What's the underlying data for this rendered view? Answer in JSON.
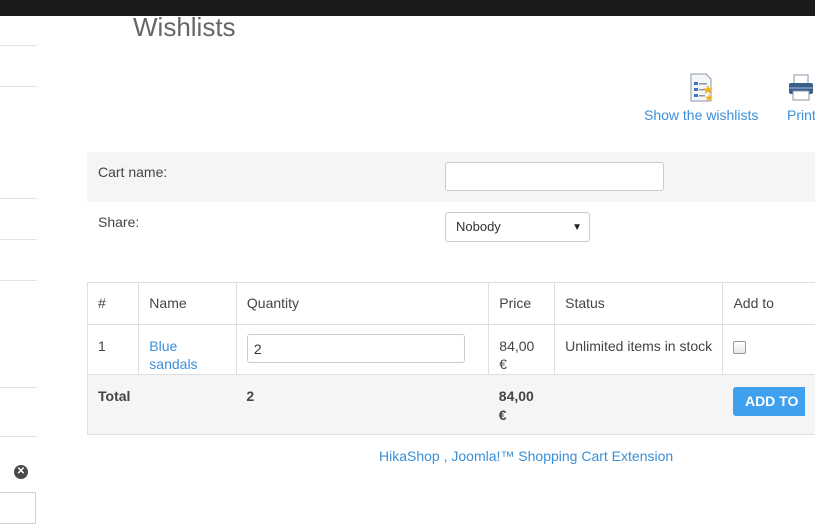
{
  "page": {
    "title": "Wishlists"
  },
  "toolbar": {
    "show_wishlists_label": "Show the wishlists",
    "print_label": "Print"
  },
  "form": {
    "cart_name_label": "Cart name:",
    "cart_name_value": "",
    "share_label": "Share:",
    "share_selected": "Nobody"
  },
  "table": {
    "headers": {
      "num": "#",
      "name": "Name",
      "quantity": "Quantity",
      "price": "Price",
      "status": "Status",
      "add_to": "Add to"
    },
    "rows": [
      {
        "num": "1",
        "name": "Blue sandals",
        "quantity": "2",
        "price": "84,00 €",
        "status": "Unlimited items in stock"
      }
    ],
    "total": {
      "label": "Total",
      "quantity": "2",
      "price": "84,00 €",
      "button": "ADD TO"
    }
  },
  "footer": {
    "credit": "HikaShop , Joomla!™ Shopping Cart Extension"
  },
  "colors": {
    "link": "#3a8fd9",
    "button": "#3ea0ee",
    "topbar": "#1b1b1b"
  },
  "icons": {
    "wishlist": "wishlist-list-star-icon",
    "print": "printer-icon",
    "close": "close-circle-icon"
  }
}
